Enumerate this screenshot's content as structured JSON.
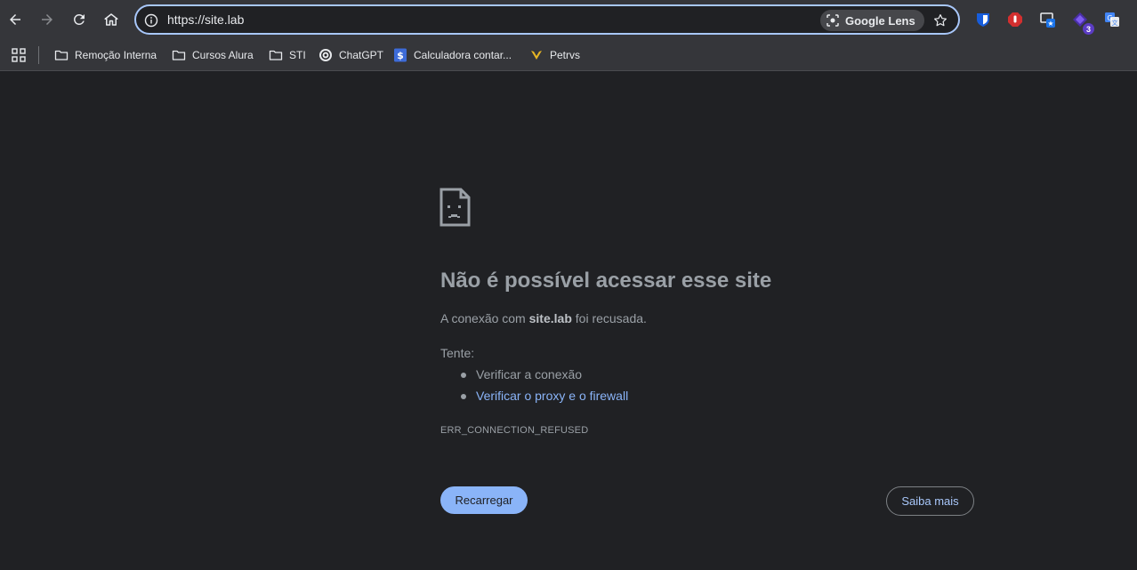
{
  "browser": {
    "url": "https://site.lab",
    "lens_label": "Google Lens",
    "extensions": [
      {
        "name": "bitwarden-icon",
        "color": "#175ddc"
      },
      {
        "name": "adblock-icon",
        "color": "#d32f2f"
      },
      {
        "name": "tab-manager-icon",
        "badge": ""
      },
      {
        "name": "purple-extension-icon",
        "badge": "3"
      },
      {
        "name": "google-translate-icon",
        "color": "#4285f4"
      }
    ]
  },
  "bookmarks": [
    {
      "label": "Remoção Interna",
      "icon": "folder-icon"
    },
    {
      "label": "Cursos Alura",
      "icon": "folder-icon"
    },
    {
      "label": "STI",
      "icon": "folder-icon"
    },
    {
      "label": "ChatGPT",
      "icon": "chatgpt-icon"
    },
    {
      "label": "Calculadora contar...",
      "icon": "calculator-icon"
    },
    {
      "label": "Petrvs",
      "icon": "petrvs-icon"
    }
  ],
  "error": {
    "title": "Não é possível acessar esse site",
    "desc_prefix": "A conexão com ",
    "host": "site.lab",
    "desc_suffix": " foi recusada.",
    "try_label": "Tente:",
    "suggestions": [
      "Verificar a conexão",
      "Verificar o proxy e o firewall"
    ],
    "code": "ERR_CONNECTION_REFUSED",
    "reload_label": "Recarregar",
    "learn_more_label": "Saiba mais"
  },
  "colors": {
    "page_bg": "#202124",
    "toolbar_bg": "#35363a",
    "accent": "#8ab4f8",
    "text_muted": "#9aa0a6"
  }
}
